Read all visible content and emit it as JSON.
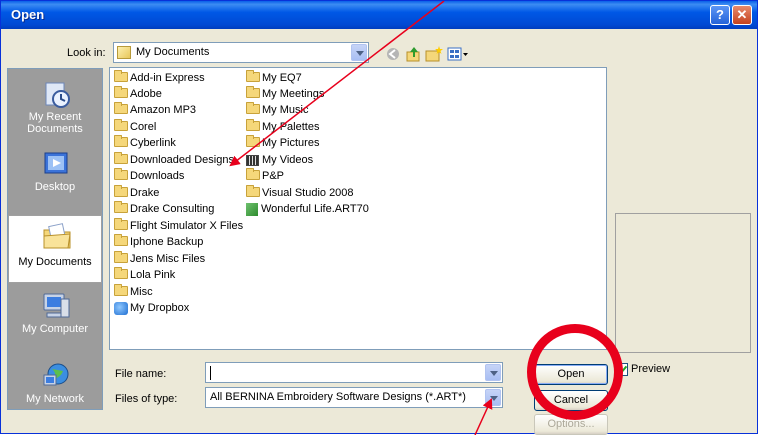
{
  "window": {
    "title": "Open",
    "help_glyph": "?",
    "close_glyph": "✕"
  },
  "look_in": {
    "label": "Look in:",
    "value": "My Documents"
  },
  "places": [
    {
      "label": "My Recent Documents",
      "icon": "recent-documents-icon"
    },
    {
      "label": "Desktop",
      "icon": "desktop-icon"
    },
    {
      "label": "My Documents",
      "icon": "my-documents-icon"
    },
    {
      "label": "My Computer",
      "icon": "my-computer-icon"
    },
    {
      "label": "My Network",
      "icon": "my-network-icon"
    }
  ],
  "files_col1": [
    "Add-in Express",
    "Adobe",
    "Amazon MP3",
    "Corel",
    "Cyberlink",
    "Downloaded Designs",
    "Downloads",
    "Drake",
    "Drake Consulting",
    "Flight Simulator X Files",
    "Iphone Backup",
    "Jens Misc Files",
    "Lola Pink",
    "Misc",
    "My Dropbox"
  ],
  "files_col2": [
    "My EQ7",
    "My Meetings",
    "My Music",
    "My Palettes",
    "My Pictures",
    "My Videos",
    "P&P",
    "Visual Studio 2008",
    "Wonderful Life.ART70"
  ],
  "file_name": {
    "label": "File name:",
    "value": ""
  },
  "file_type": {
    "label": "Files of type:",
    "value": "All BERNINA Embroidery Software Designs (*.ART*)"
  },
  "buttons": {
    "open": "Open",
    "cancel": "Cancel",
    "options": "Options..."
  },
  "preview": {
    "label": "Preview",
    "checked": true
  },
  "colors": {
    "titlebar": "#0058e6",
    "annotation": "#e8001c"
  }
}
